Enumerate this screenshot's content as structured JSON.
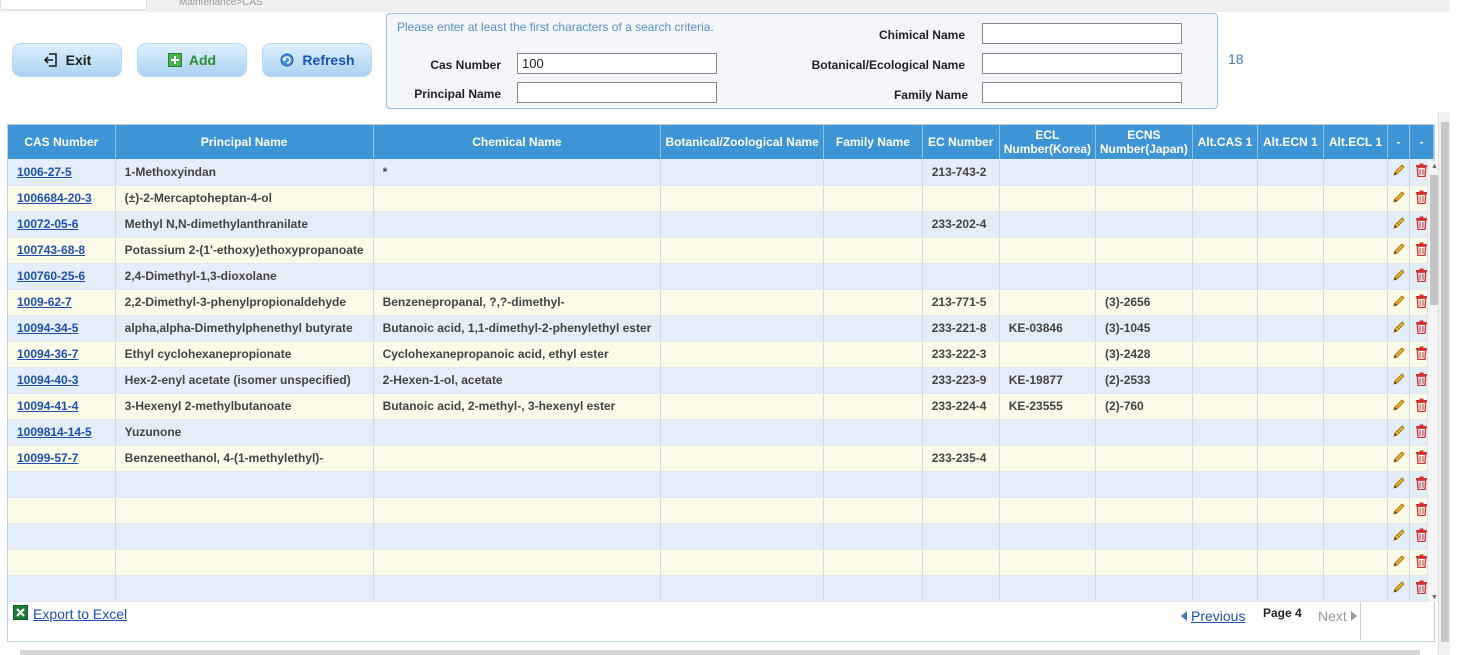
{
  "breadcrumb": "Maintenance>CAS",
  "toolbar": {
    "exit_label": "Exit",
    "add_label": "Add",
    "refresh_label": "Refresh"
  },
  "search": {
    "hint": "Please enter at least the first characters of a search criteria.",
    "cas_label": "Cas Number",
    "cas_value": "100",
    "principal_label": "Principal Name",
    "principal_value": "",
    "chimical_label": "Chimical Name",
    "chimical_value": "",
    "botanical_label": "Botanical/Ecological Name",
    "botanical_value": "",
    "family_label": "Family Name",
    "family_value": ""
  },
  "result_count": "18",
  "table": {
    "columns": [
      "CAS Number",
      "Principal Name",
      "Chemical Name",
      "Botanical/Zoological Name",
      "Family Name",
      "EC Number",
      "ECL Number(Korea)",
      "ECNS Number(Japan)",
      "Alt.CAS 1",
      "Alt.ECN 1",
      "Alt.ECL 1",
      "-",
      "-"
    ],
    "rows": [
      [
        "1006-27-5",
        "1-Methoxyindan",
        "*",
        "",
        "",
        "213-743-2",
        "",
        "",
        "",
        "",
        ""
      ],
      [
        "1006684-20-3",
        "(±)-2-Mercaptoheptan-4-ol",
        "",
        "",
        "",
        "",
        "",
        "",
        "",
        "",
        ""
      ],
      [
        "10072-05-6",
        "Methyl N,N-dimethylanthranilate",
        "",
        "",
        "",
        "233-202-4",
        "",
        "",
        "",
        "",
        ""
      ],
      [
        "100743-68-8",
        "Potassium 2-(1'-ethoxy)ethoxypropanoate",
        "",
        "",
        "",
        "",
        "",
        "",
        "",
        "",
        ""
      ],
      [
        "100760-25-6",
        "2,4-Dimethyl-1,3-dioxolane",
        "",
        "",
        "",
        "",
        "",
        "",
        "",
        "",
        ""
      ],
      [
        "1009-62-7",
        "2,2-Dimethyl-3-phenylpropionaldehyde",
        "Benzenepropanal, ?,?-dimethyl-",
        "",
        "",
        "213-771-5",
        "",
        "(3)-2656",
        "",
        "",
        ""
      ],
      [
        "10094-34-5",
        "alpha,alpha-Dimethylphenethyl butyrate",
        "Butanoic acid, 1,1-dimethyl-2-phenylethyl ester",
        "",
        "",
        "233-221-8",
        "KE-03846",
        "(3)-1045",
        "",
        "",
        ""
      ],
      [
        "10094-36-7",
        "Ethyl cyclohexanepropionate",
        "Cyclohexanepropanoic acid, ethyl ester",
        "",
        "",
        "233-222-3",
        "",
        "(3)-2428",
        "",
        "",
        ""
      ],
      [
        "10094-40-3",
        "Hex-2-enyl acetate (isomer unspecified)",
        "2-Hexen-1-ol, acetate",
        "",
        "",
        "233-223-9",
        "KE-19877",
        "(2)-2533",
        "",
        "",
        ""
      ],
      [
        "10094-41-4",
        "3-Hexenyl 2-methylbutanoate",
        "Butanoic acid, 2-methyl-, 3-hexenyl ester",
        "",
        "",
        "233-224-4",
        "KE-23555",
        "(2)-760",
        "",
        "",
        ""
      ],
      [
        "1009814-14-5",
        "Yuzunone",
        "",
        "",
        "",
        "",
        "",
        "",
        "",
        "",
        ""
      ],
      [
        "10099-57-7",
        "Benzeneethanol, 4-(1-methylethyl)-",
        "",
        "",
        "",
        "233-235-4",
        "",
        "",
        "",
        "",
        ""
      ],
      [
        "",
        "",
        "",
        "",
        "",
        "",
        "",
        "",
        "",
        "",
        ""
      ],
      [
        "",
        "",
        "",
        "",
        "",
        "",
        "",
        "",
        "",
        "",
        ""
      ],
      [
        "",
        "",
        "",
        "",
        "",
        "",
        "",
        "",
        "",
        "",
        ""
      ],
      [
        "",
        "",
        "",
        "",
        "",
        "",
        "",
        "",
        "",
        "",
        ""
      ],
      [
        "",
        "",
        "",
        "",
        "",
        "",
        "",
        "",
        "",
        "",
        ""
      ]
    ]
  },
  "footer": {
    "export_label": "Export to Excel",
    "previous_label": "Previous",
    "page_label": "Page 4",
    "next_label": "Next"
  },
  "icons": {
    "exit": "exit-icon",
    "add": "plus-icon",
    "refresh": "refresh-icon",
    "edit": "pencil-icon",
    "delete": "trash-icon",
    "excel": "excel-icon"
  },
  "colors": {
    "header_bg": "#3e95d6",
    "row_odd": "#e4eef8",
    "row_even": "#fcfbe9",
    "link": "#1f4fb0",
    "delete": "#d32f2f",
    "edit": "#e2a21b"
  }
}
